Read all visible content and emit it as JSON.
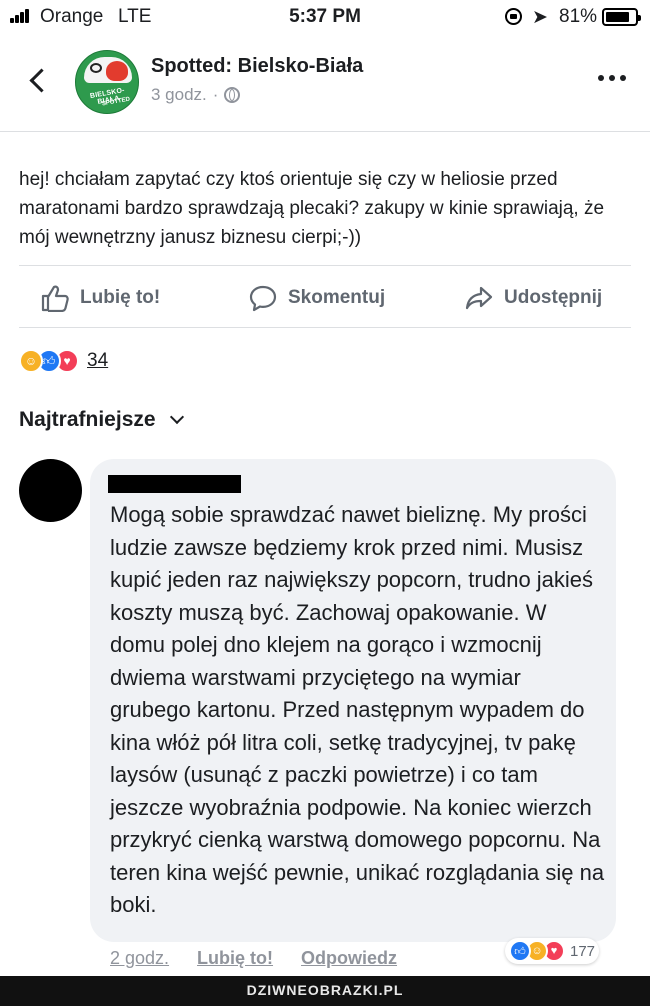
{
  "status_bar": {
    "carrier": "Orange",
    "network": "LTE",
    "time": "5:37 PM",
    "battery_percent": "81%",
    "battery_level": 0.81,
    "icons": [
      "signal-icon",
      "rotation-lock-icon",
      "location-arrow-icon",
      "battery-icon"
    ]
  },
  "header": {
    "page_name": "Spotted: Bielsko-Biała",
    "post_time": "3 godz.",
    "separator": "·",
    "avatar_text_line1": "BIELSKO-BIAŁA",
    "avatar_text_line2": "SPOTTED"
  },
  "post": {
    "text": "hej! chciałam zapytać czy ktoś orientuje się czy w heliosie przed maratonami bardzo sprawdzają plecaki? zakupy w kinie sprawiają, że mój wewnętrzny janusz biznesu cierpi;-))"
  },
  "actions": {
    "like_label": "Lubię to!",
    "comment_label": "Skomentuj",
    "share_label": "Udostępnij"
  },
  "reactions": {
    "count": "34",
    "types": [
      "haha",
      "like",
      "love"
    ]
  },
  "comments_section": {
    "sort_label": "Najtrafniejsze"
  },
  "comment": {
    "text": "Mogą sobie sprawdzać nawet bieliznę. My prości ludzie zawsze będziemy krok przed nimi. Musisz kupić jeden raz największy popcorn, trudno jakieś koszty muszą być. Zachowaj opakowanie. W domu polej dno klejem na gorąco i wzmocnij dwiema warstwami przyciętego na wymiar grubego kartonu. Przed następnym wypadem do kina włóż pół litra coli, setkę tradycyjnej, tv pakę laysów (usunąć z paczki powietrze) i co tam jeszcze wyobraźnia podpowie. Na koniec wierzch przykryć cienką warstwą domowego popcornu. Na teren kina wejść pewnie, unikać rozglądania się na boki.",
    "time": "2 godz.",
    "like_label": "Lubię to!",
    "reply_label": "Odpowiedz",
    "reaction_count": "177",
    "reaction_types": [
      "like",
      "haha",
      "love"
    ]
  },
  "watermark": {
    "text": "DZIWNEOBRAZKI.PL"
  },
  "colors": {
    "like_blue": "#2078f4",
    "haha_yellow": "#f7b125",
    "love_red": "#f33e58",
    "secondary_text": "#90949c",
    "bubble_bg": "#f0f2f5"
  }
}
